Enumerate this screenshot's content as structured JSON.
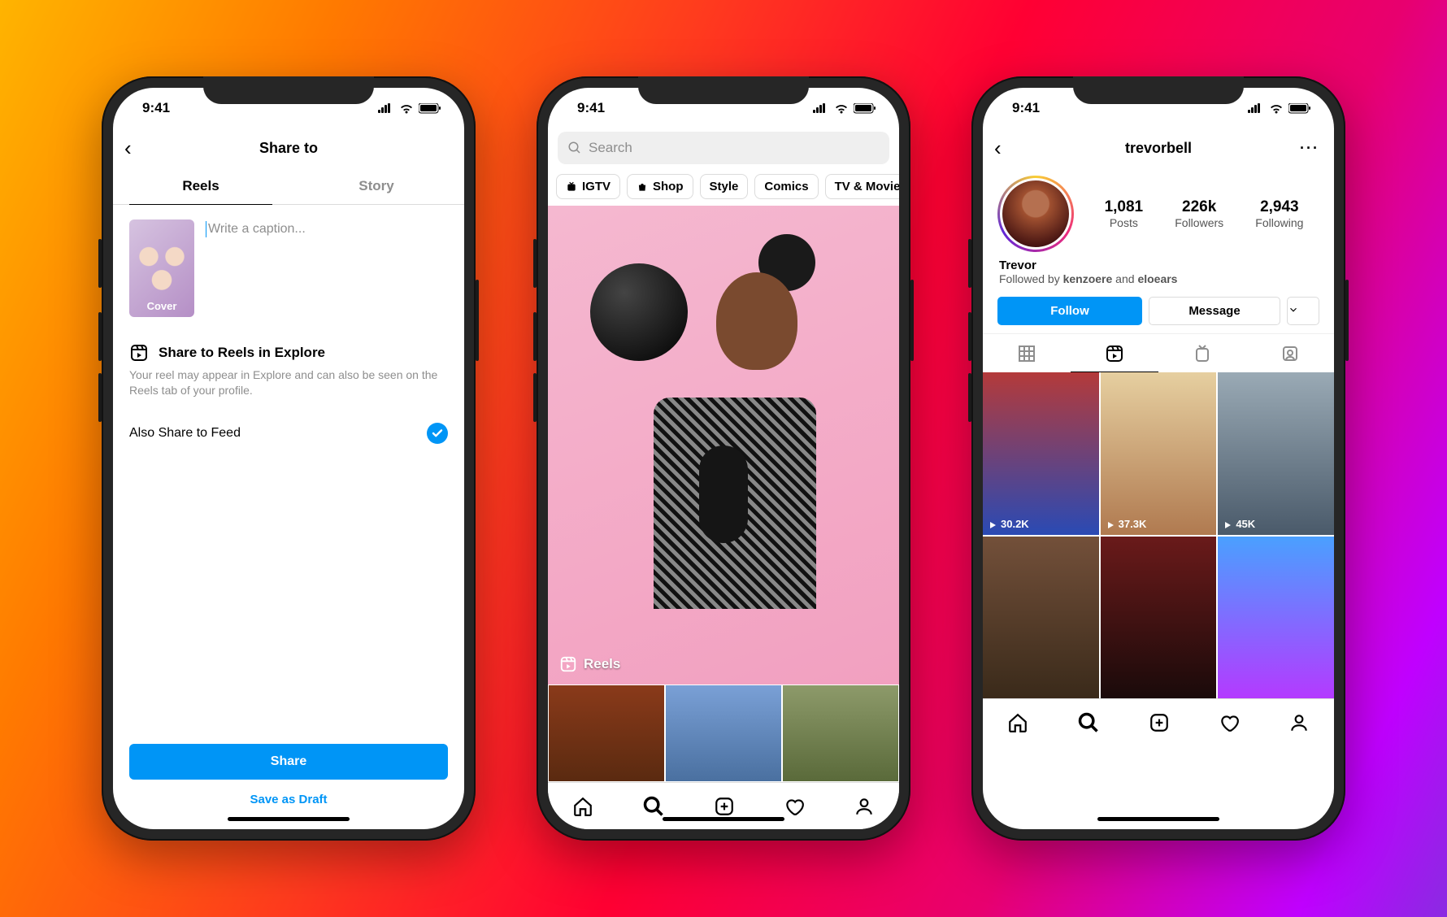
{
  "status_time": "9:41",
  "phone1": {
    "title": "Share to",
    "tabs": [
      "Reels",
      "Story"
    ],
    "cover_label": "Cover",
    "caption_placeholder": "Write a caption...",
    "explore_title": "Share to Reels in Explore",
    "explore_desc": "Your reel may appear in Explore and can also be seen on the Reels tab of your profile.",
    "feed_label": "Also Share to Feed",
    "share_btn": "Share",
    "draft_btn": "Save as Draft"
  },
  "phone2": {
    "search_placeholder": "Search",
    "chips": [
      "IGTV",
      "Shop",
      "Style",
      "Comics",
      "TV & Movies"
    ],
    "hero_badge": "Reels"
  },
  "phone3": {
    "username": "trevorbell",
    "stats": [
      {
        "num": "1,081",
        "label": "Posts"
      },
      {
        "num": "226k",
        "label": "Followers"
      },
      {
        "num": "2,943",
        "label": "Following"
      }
    ],
    "display_name": "Trevor",
    "followed_prefix": "Followed by ",
    "followed_1": "kenzoere",
    "followed_and": " and ",
    "followed_2": "eloears",
    "follow_btn": "Follow",
    "message_btn": "Message",
    "views": [
      "30.2K",
      "37.3K",
      "45K"
    ]
  }
}
